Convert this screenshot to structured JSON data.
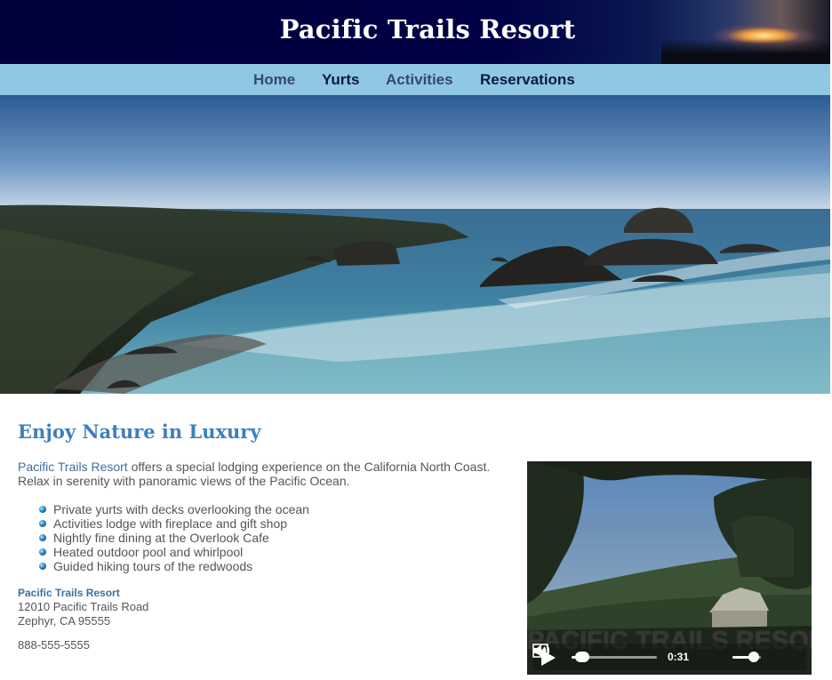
{
  "header": {
    "title": "Pacific Trails Resort"
  },
  "nav": {
    "items": [
      {
        "label": "Home"
      },
      {
        "label": "Yurts"
      },
      {
        "label": "Activities"
      },
      {
        "label": "Reservations"
      }
    ]
  },
  "hero": {
    "icon": "coastline-photo"
  },
  "main": {
    "heading": "Enjoy Nature in Luxury",
    "intro_brand": "Pacific Trails Resort",
    "intro_text": " offers a special lodging experience on the California North Coast. Relax in serenity with panoramic views of the Pacific Ocean.",
    "features": [
      "Private yurts with decks overlooking the ocean",
      "Activities lodge with fireplace and gift shop",
      "Nightly fine dining at the Overlook Cafe",
      "Heated outdoor pool and whirlpool",
      "Guided hiking tours of the redwoods"
    ]
  },
  "contact": {
    "org": "Pacific Trails Resort",
    "street": "12010 Pacific Trails Road",
    "city": "Zephyr, CA 95555",
    "phone": "888-555-5555"
  },
  "video": {
    "watermark": "PACIFIC TRAILS RESORT",
    "time": "0:31",
    "progress": 0.1,
    "volume": 0.75
  },
  "colors": {
    "header_bg": "#000033",
    "nav_bg": "#90c7e3",
    "heading": "#3f7fbf",
    "text": "#555555"
  }
}
